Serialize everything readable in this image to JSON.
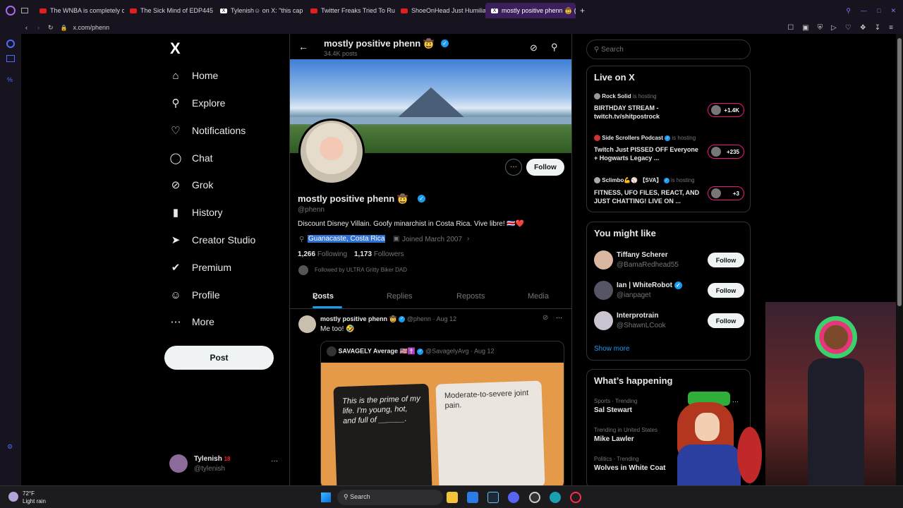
{
  "browser": {
    "tabs": [
      {
        "title": "The WNBA is completely c"
      },
      {
        "title": "The Sick Mind of EDP445"
      },
      {
        "title": "Tylenish☺ on X: \"this cap"
      },
      {
        "title": "Twitter Freaks Tried To Ru"
      },
      {
        "title": "ShoeOnHead Just Humiliat"
      },
      {
        "title": "mostly positive phenn 🤠 (@"
      }
    ],
    "new_tab": "+",
    "url": "x.com/phenn"
  },
  "nav": {
    "logo": "X",
    "items": [
      {
        "label": "Home",
        "icon": "home-icon"
      },
      {
        "label": "Explore",
        "icon": "search-icon"
      },
      {
        "label": "Notifications",
        "icon": "bell-icon"
      },
      {
        "label": "Chat",
        "icon": "chat-icon"
      },
      {
        "label": "Grok",
        "icon": "grok-icon"
      },
      {
        "label": "History",
        "icon": "bookmark-icon"
      },
      {
        "label": "Creator Studio",
        "icon": "rocket-icon"
      },
      {
        "label": "Premium",
        "icon": "verified-badge-icon"
      },
      {
        "label": "Profile",
        "icon": "person-icon"
      },
      {
        "label": "More",
        "icon": "more-circle-icon"
      }
    ],
    "post_label": "Post",
    "account": {
      "name": "Tylenish",
      "badge": "18",
      "handle": "@tylenish",
      "menu": "···"
    }
  },
  "profile": {
    "header_name": "mostly positive phenn 🤠",
    "post_count": "34.4K posts",
    "display_name": "mostly positive phenn 🤠",
    "handle": "@phenn",
    "bio": "Discount Disney Villain. Goofy minarchist in Costa Rica. Vive libre! 🇨🇷❤️",
    "location": "Guanacaste, Costa Rica",
    "joined": "Joined March 2007",
    "following_count": "1,266",
    "following_label": "Following",
    "followers_count": "1,173",
    "followers_label": "Followers",
    "followed_by": "Followed by ULTRA Gritty Biker DAD",
    "follow_label": "Follow",
    "more_label": "···",
    "tabs": [
      "Posts",
      "Replies",
      "Reposts",
      "Media"
    ]
  },
  "post": {
    "author": "mostly positive phenn 🤠",
    "handle": "@phenn",
    "date": "· Aug 12",
    "text": "Me too! 🤣",
    "menu": "···",
    "quote": {
      "author": "SAVAGELY Average 🇺🇸✝️",
      "handle": "@SavagelyAvg",
      "date": "· Aug 12",
      "card_black": "This is the prime of my life. I'm young, hot, and full of ______.",
      "card_white": "Moderate-to-severe joint pain."
    }
  },
  "sidebar": {
    "search_placeholder": "Search",
    "live": {
      "title": "Live on X",
      "items": [
        {
          "host": "Rock Solid",
          "hosting": "is hosting",
          "title": "BIRTHDAY STREAM - twitch.tv/shitpostrock",
          "count": "+1.4K"
        },
        {
          "host": "Side Scrollers Podcast",
          "hosting": "is hosting",
          "title": "Twitch Just PISSED OFF Everyone + Hogwarts Legacy ...",
          "count": "+235"
        },
        {
          "host": "Sclimbo💪⚾ 【SVA】",
          "hosting": "is hosting",
          "title": "FITNESS, UFO FILES, REACT, AND JUST CHATTING! LIVE ON ...",
          "count": "+3"
        }
      ]
    },
    "suggest": {
      "title": "You might like",
      "items": [
        {
          "name": "Tiffany Scherer",
          "handle": "@BamaRedhead55",
          "verified": false
        },
        {
          "name": "Ian | WhiteRobot",
          "handle": "@ianpaget",
          "verified": true
        },
        {
          "name": "Interprotrain",
          "handle": "@ShawnLCook",
          "verified": false
        }
      ],
      "follow_label": "Follow",
      "show_more": "Show more"
    },
    "trends": {
      "title": "What’s happening",
      "items": [
        {
          "context": "Sports · Trending",
          "name": "Sal Stewart"
        },
        {
          "context": "Trending in United States",
          "name": "Mike Lawler"
        },
        {
          "context": "Politics · Trending",
          "name": "Wolves in White Coat"
        }
      ]
    }
  },
  "taskbar": {
    "weather_temp": "72°F",
    "weather_desc": "Light rain",
    "search_label": "Search"
  }
}
